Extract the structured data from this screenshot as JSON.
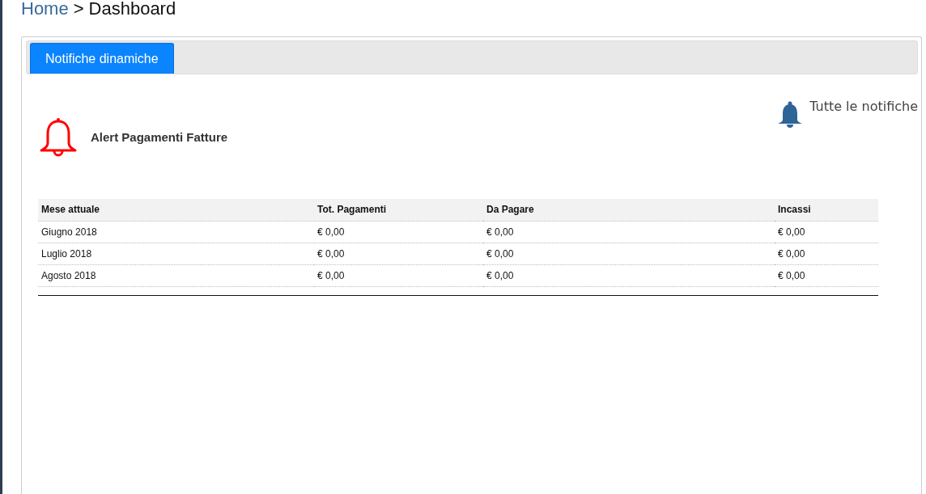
{
  "breadcrumb": {
    "home": "Home",
    "separator": ">",
    "current": "Dashboard"
  },
  "tabs": [
    {
      "label": "Notifiche dinamiche",
      "selected": true
    }
  ],
  "all_notifications": {
    "label": "Tutte le notifiche"
  },
  "alert": {
    "title": "Alert Pagamenti Fatture"
  },
  "table": {
    "columns": [
      "Mese attuale",
      "Tot. Pagamenti",
      "Da Pagare",
      "Incassi"
    ],
    "rows": [
      [
        "Giugno 2018",
        "€ 0,00",
        "€ 0,00",
        "€ 0,00"
      ],
      [
        "Luglio 2018",
        "€ 0,00",
        "€ 0,00",
        "€ 0,00"
      ],
      [
        "Agosto 2018",
        "€ 0,00",
        "€ 0,00",
        "€ 0,00"
      ]
    ]
  }
}
